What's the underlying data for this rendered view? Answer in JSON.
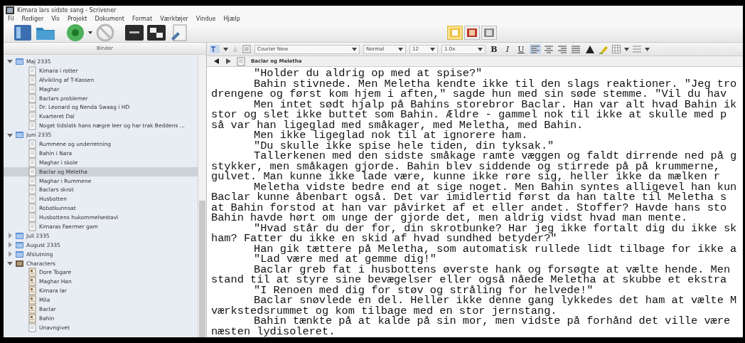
{
  "window": {
    "title": "Kimara lars sidste sang - Scrivener"
  },
  "menu": [
    "Fil",
    "Rediger",
    "Vis",
    "Projekt",
    "Dokument",
    "Format",
    "Værktøjer",
    "Vindue",
    "Hjælp"
  ],
  "view_modes": [
    {
      "selected": true
    },
    {
      "selected": false
    },
    {
      "selected": false
    }
  ],
  "binder": {
    "title": "Binder",
    "items": [
      {
        "label": "Maj 2335",
        "kind": "folder",
        "expanded": true,
        "selected": false,
        "children": [
          {
            "label": "Kimara i rotter",
            "kind": "doc",
            "selected": false
          },
          {
            "label": "Afvikling af T-Kassen",
            "kind": "doc",
            "selected": false
          },
          {
            "label": "Maghar",
            "kind": "doc",
            "selected": false
          },
          {
            "label": "Baclars problemer",
            "kind": "doc",
            "selected": false
          },
          {
            "label": "Dr. Leonard og Nenda Swaag i HD",
            "kind": "doc",
            "selected": false
          },
          {
            "label": "Kvarteret Dal",
            "kind": "doc",
            "selected": false
          },
          {
            "label": "Noget tidslatk hans nægre leer og har trak Beddens ...",
            "kind": "doc",
            "selected": false
          }
        ]
      },
      {
        "label": "Juni 2335",
        "kind": "folder",
        "expanded": true,
        "selected": false,
        "children": [
          {
            "label": "Rummene og underretning",
            "kind": "doc",
            "selected": false
          },
          {
            "label": "Bahin i Nara",
            "kind": "doc",
            "selected": false
          },
          {
            "label": "Maghar i skole",
            "kind": "doc",
            "selected": false
          },
          {
            "label": "Baclar og Meletha",
            "kind": "doc",
            "selected": true
          },
          {
            "label": "Maghar i Rummene",
            "kind": "doc",
            "selected": false
          },
          {
            "label": "Baclars skrot",
            "kind": "doc",
            "selected": false
          },
          {
            "label": "Husbotten",
            "kind": "doc",
            "selected": false
          },
          {
            "label": "Robotkunnsat",
            "kind": "doc",
            "selected": false
          },
          {
            "label": "Husbottens hukommelsestavl",
            "kind": "doc",
            "selected": false
          },
          {
            "label": "Kimaras Faermer gam",
            "kind": "doc",
            "selected": false
          }
        ]
      },
      {
        "label": "Juli 2335",
        "kind": "folder",
        "expanded": false,
        "selected": false
      },
      {
        "label": "August 2335",
        "kind": "folder",
        "expanded": false,
        "selected": false
      },
      {
        "label": "Afslutning",
        "kind": "folder",
        "expanded": false,
        "selected": false
      },
      {
        "label": "Characters",
        "kind": "character-folder",
        "expanded": true,
        "selected": false,
        "children": [
          {
            "label": "Dore Togare",
            "kind": "character",
            "selected": false
          },
          {
            "label": "Maghar Han",
            "kind": "character",
            "selected": false
          },
          {
            "label": "Kimara Iar",
            "kind": "character",
            "selected": false
          },
          {
            "label": "Mila",
            "kind": "character",
            "selected": false
          },
          {
            "label": "Baclar",
            "kind": "character",
            "selected": false
          },
          {
            "label": "Bahin",
            "kind": "character",
            "selected": false
          },
          {
            "label": "Unavngivet",
            "kind": "doc",
            "selected": false
          }
        ]
      }
    ]
  },
  "format_bar": {
    "font": "Courier New",
    "style": "Normal",
    "size": "12",
    "spacing": "1.0x",
    "bold": "B",
    "italic": "I",
    "underline": "U",
    "alignments": [
      {
        "selected": true
      },
      {
        "selected": false
      },
      {
        "selected": false
      },
      {
        "selected": false
      }
    ]
  },
  "document": {
    "title": "Baclar og Meletha",
    "lines": [
      {
        "text": "\"Holder du aldrig op med at spise?\"",
        "indent": true
      },
      {
        "text": "Bahin stivnede. Men Meletha kendte ikke til den slags reaktioner. \"Jeg tro",
        "indent": true
      },
      {
        "text": "drengene og først kom hjem i aften,\" sagde hun med sin søde stemme. \"Vil du hav",
        "indent": false
      },
      {
        "text": "Men intet sødt hjalp på Bahins storebror Baclar. Han var alt hvad Bahin ik",
        "indent": true
      },
      {
        "text": "stor og slet ikke buttet som Bahin. Ældre - gammel nok til ikke at skulle med p",
        "indent": false
      },
      {
        "text": "så var han ligeglad med småkager, med Meletha, med Bahin.",
        "indent": false
      },
      {
        "text": "Men ikke ligeglad nok til at ignorere ham.",
        "indent": true
      },
      {
        "text": "\"Du skulle ikke spise hele tiden, din tyksak.\"",
        "indent": true
      },
      {
        "text": "Tallerkenen med den sidste småkage ramte væggen og faldt dirrende ned på g",
        "indent": true
      },
      {
        "text": "stykker, men småkagen gjorde. Bahin blev siddende og stirrede på på krummerne,",
        "indent": false
      },
      {
        "text": "gulvet. Man kunne ikke lade være, kunne ikke røre sig, heller ikke da mælken r",
        "indent": false
      },
      {
        "text": "Meletha vidste bedre end at sige noget. Men Bahin syntes alligevel han kun",
        "indent": true
      },
      {
        "text": "Baclar kunne åbenbart også. Det var imidlertid først da han talte til Meletha s",
        "indent": false
      },
      {
        "text": "at Bahin forstod at han var påvirket af et eller andet. Stoffer? Havde hans sto",
        "indent": false
      },
      {
        "text": "Bahin havde hørt om unge der gjorde det, men aldrig vidst hvad man mente.",
        "indent": false
      },
      {
        "text": "\"Hvad står du der for, din skrotbunke? Har jeg ikke fortalt dig du ikke sk",
        "indent": true
      },
      {
        "text": "ham? Fatter du ikke en skid af hvad sundhed betyder?\"",
        "indent": false
      },
      {
        "text": "Han gik tættere på Meletha, som automatisk rullede lidt tilbage for ikke a",
        "indent": true
      },
      {
        "text": "\"Lad være med at gemme dig!\"",
        "indent": true
      },
      {
        "text": "Baclar greb fat i husbottens øverste hank og forsøgte at vælte hende. Men",
        "indent": true
      },
      {
        "text": "stand til at styre sine bevægelser eller også nåede Meletha at skubbe et ekstra",
        "indent": false
      },
      {
        "text": "\"I Renoen med dig for støv og stråling for helvede!\"",
        "indent": true
      },
      {
        "text": "Baclar snøvlede en del. Heller ikke denne gang lykkedes det ham at vælte M",
        "indent": true
      },
      {
        "text": "værkstedsrummet og kom tilbage med en stor jernstang.",
        "indent": false
      },
      {
        "text": "Bahin tænkte på at kalde på sin mor, men vidste på forhånd det ville være",
        "indent": true
      },
      {
        "text": "næsten lydisoleret.",
        "indent": false
      }
    ]
  }
}
